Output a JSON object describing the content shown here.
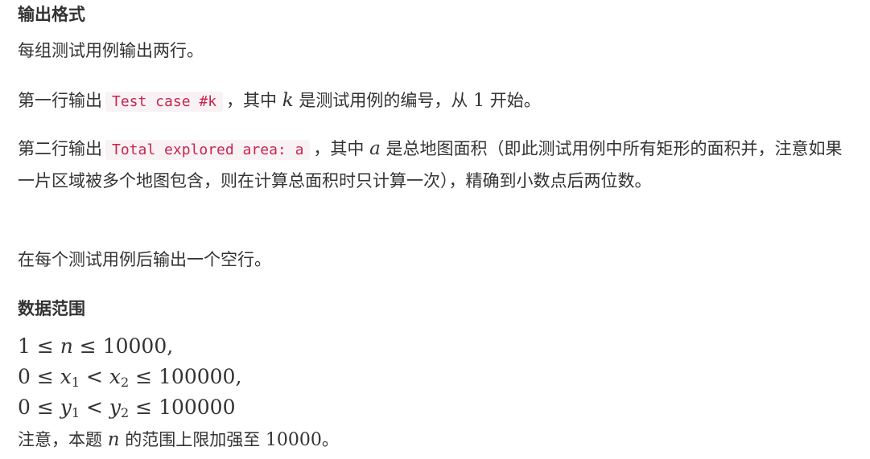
{
  "output_format": {
    "heading": "输出格式",
    "intro": "每组测试用例输出两行。",
    "line1": {
      "prefix": "第一行输出",
      "code": "Test case #k",
      "mid": "，其中",
      "var": "k",
      "suffix_a": "是测试用例的编号，从",
      "num": "1",
      "suffix_b": "开始。"
    },
    "line2": {
      "prefix": "第二行输出",
      "code": "Total explored area: a",
      "mid": "，其中",
      "var": "a",
      "suffix": "是总地图面积（即此测试用例中所有矩形的面积并，注意如果一片区域被多个地图包含，则在计算总面积时只计算一次），精确到小数点后两位数。"
    },
    "line3": "在每个测试用例后输出一个空行。"
  },
  "data_range": {
    "heading": "数据范围",
    "n_range": {
      "lo": "1",
      "var": "n",
      "hi": "10000",
      "tail": ","
    },
    "x_range": {
      "lo": "0",
      "var1": "x",
      "sub1": "1",
      "var2": "x",
      "sub2": "2",
      "hi": "100000",
      "tail": ","
    },
    "y_range": {
      "lo": "0",
      "var1": "y",
      "sub1": "1",
      "var2": "y",
      "sub2": "2",
      "hi": "100000"
    },
    "note": {
      "prefix": "注意，本题",
      "var": "n",
      "mid": "的范围上限加强至",
      "num": "10000",
      "suffix": "。"
    }
  }
}
